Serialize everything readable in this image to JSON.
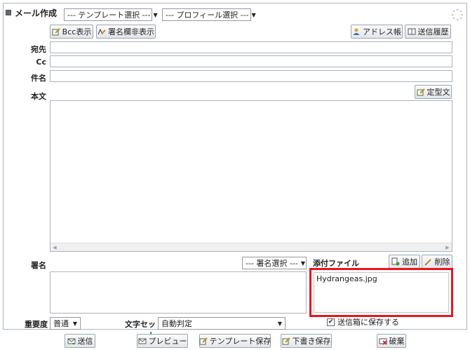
{
  "title": "メール作成",
  "template_select": "--- テンプレート選択 ---",
  "profile_select": "--- プロフィール選択 ---",
  "toolbar": {
    "bcc": "Bcc表示",
    "signature_toggle": "署名欄非表示",
    "address_book": "アドレス帳",
    "history": "送信履歴"
  },
  "fields": {
    "to_label": "宛先",
    "cc_label": "Cc",
    "subject_label": "件名",
    "body_label": "本文"
  },
  "template_text_button": "定型文",
  "signature": {
    "label": "署名",
    "select": "--- 署名選択 ---"
  },
  "attachment": {
    "label": "添付ファイル",
    "add": "追加",
    "delete": "削除",
    "files": [
      "Hydrangeas.jpg"
    ]
  },
  "save_sent": "送信箱に保存する",
  "priority": {
    "label": "重要度",
    "value": "普通"
  },
  "charset": {
    "label": "文字セット",
    "value": "自動判定"
  },
  "footer": {
    "send": "送信",
    "preview": "プレビュー",
    "save_template": "テンプレート保存",
    "save_draft": "下書き保存",
    "discard": "破棄"
  }
}
